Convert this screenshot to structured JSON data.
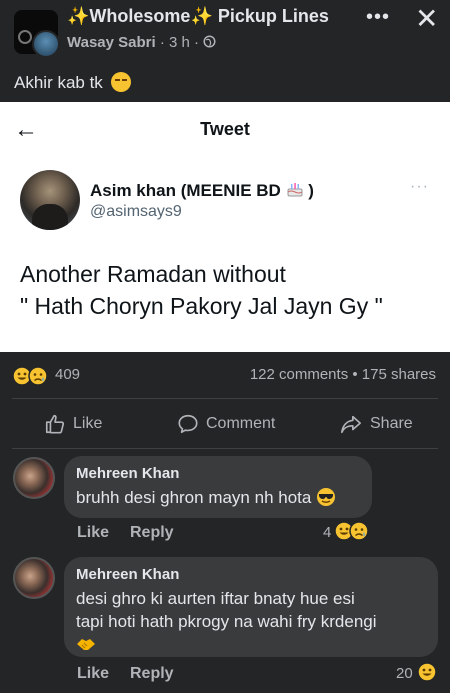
{
  "post": {
    "group_name": "Wholesome",
    "group_name_suffix": "Pickup Lines",
    "sparkle_icon": "✨",
    "author": "Wasay Sabri",
    "time": "3 h",
    "privacy_icon": "globe-icon",
    "more_icon": "•••",
    "close_icon": "✕",
    "text": "Akhir kab tk"
  },
  "tweet": {
    "header_title": "Tweet",
    "back_icon": "←",
    "name": "Asim khan (MEENIE BD",
    "name_suffix": ")",
    "handle": "@asimsays9",
    "more_icon": "···",
    "text": "Another Ramadan without\n\" Hath Choryn Pakory Jal Jayn Gy \""
  },
  "stats": {
    "reactions_count": "409",
    "comments_shares": "122 comments • 175 shares"
  },
  "actions": {
    "like": "Like",
    "comment": "Comment",
    "share": "Share"
  },
  "comments": [
    {
      "name": "Mehreen Khan",
      "text": "bruhh desi ghron mayn nh hota",
      "like": "Like",
      "reply": "Reply",
      "reaction_count": "4"
    },
    {
      "name": "Mehreen Khan",
      "text_line1": "desi ghro ki aurten iftar bnaty hue esi",
      "text_line2": "tapi hoti hath pkrogy na wahi fry krdengi",
      "like": "Like",
      "reply": "Reply",
      "reaction_count": "20"
    }
  ],
  "colors": {
    "background": "#242526",
    "bubble": "#3a3b3c",
    "text_primary": "#e4e6eb",
    "text_secondary": "#b0b3b8"
  }
}
